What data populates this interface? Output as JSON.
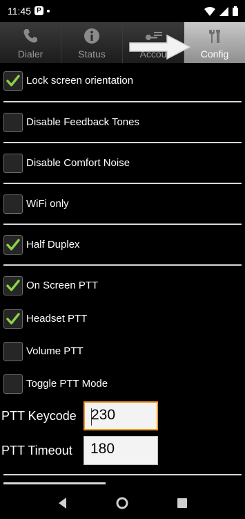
{
  "status_bar": {
    "time": "11:45",
    "notif_glyph": "P"
  },
  "tabs": [
    {
      "label": "Dialer",
      "icon": "phone-icon",
      "active": false
    },
    {
      "label": "Status",
      "icon": "info-icon",
      "active": false
    },
    {
      "label": "Accou",
      "icon": "account-key-icon",
      "active": false
    },
    {
      "label": "Config",
      "icon": "tools-icon",
      "active": true
    }
  ],
  "options": [
    {
      "label": "Lock screen orientation",
      "checked": true
    },
    {
      "label": "Disable Feedback Tones",
      "checked": false
    },
    {
      "label": "Disable Comfort Noise",
      "checked": false
    },
    {
      "label": "WiFi only",
      "checked": false
    },
    {
      "label": "Half Duplex",
      "checked": true
    },
    {
      "label": "On Screen PTT",
      "checked": true
    },
    {
      "label": "Headset PTT",
      "checked": true
    },
    {
      "label": "Volume PTT",
      "checked": false
    },
    {
      "label": "Toggle PTT Mode",
      "checked": false
    }
  ],
  "fields": {
    "ptt_keycode": {
      "label": "PTT Keycode",
      "value": "230"
    },
    "ptt_timeout": {
      "label": "PTT Timeout",
      "value": "180"
    }
  },
  "colors": {
    "accent_check": "#8bd34a",
    "focus_border": "#f39a22",
    "active_tab": "#b0b0b0"
  }
}
